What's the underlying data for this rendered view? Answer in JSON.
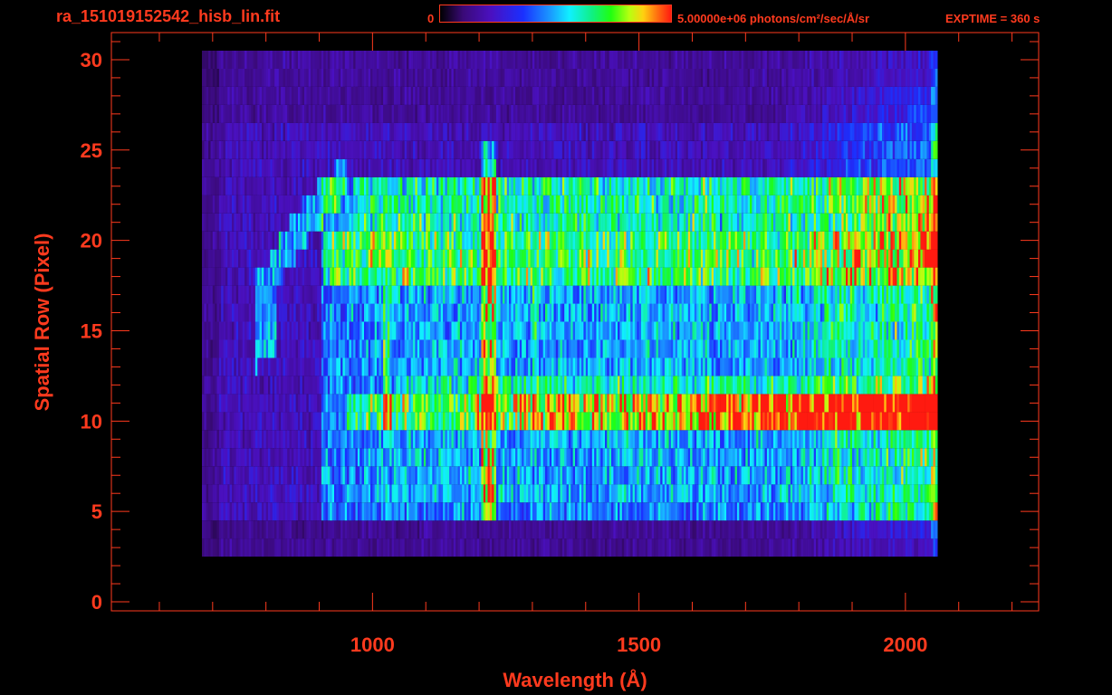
{
  "header": {
    "title": "ra_151019152542_hisb_lin.fit",
    "colorbar_min": "0",
    "colorbar_max_text": "5.00000e+06 photons/cm²/sec/Å/sr",
    "exptime": "EXPTIME = 360 s"
  },
  "colors": {
    "axis": "#ff3a1e",
    "background": "#000000"
  },
  "chart_data": {
    "type": "heatmap",
    "title": "ra_151019152542_hisb_lin.fit",
    "xlabel": "Wavelength (Å)",
    "ylabel": "Spatial Row (Pixel)",
    "xlim": [
      510,
      2250
    ],
    "ylim": [
      -0.5,
      31.5
    ],
    "x_ticks": [
      1000,
      1500,
      2000
    ],
    "y_ticks": [
      0,
      5,
      10,
      15,
      20,
      25,
      30
    ],
    "colorbar": {
      "min": 0,
      "max": 5000000,
      "units": "photons/cm²/sec/Å/sr",
      "colormap": "rainbow"
    },
    "data_extent": {
      "wavelength_range": [
        680,
        2060
      ],
      "row_range": [
        3,
        30
      ]
    },
    "features": [
      {
        "feature": "vertical emission line",
        "wavelength": 1216,
        "rows": [
          5,
          25
        ]
      },
      {
        "feature": "bright band",
        "rows": [
          10,
          11
        ],
        "wavelength_range": [
          950,
          2060
        ],
        "peak_near": 2050
      },
      {
        "feature": "bright band",
        "rows": [
          18,
          23
        ],
        "wavelength_range": [
          820,
          2060
        ]
      },
      {
        "feature": "arc",
        "rows": [
          14,
          24
        ],
        "wavelength_range": [
          780,
          950
        ]
      }
    ],
    "grid": false
  }
}
